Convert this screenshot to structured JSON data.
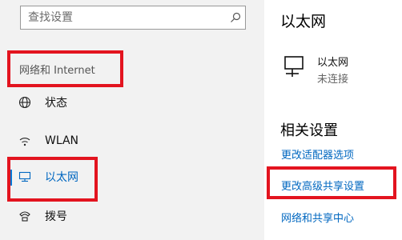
{
  "search": {
    "placeholder": "查找设置"
  },
  "sidebar": {
    "section_title": "网络和 Internet",
    "items": [
      {
        "label": "状态",
        "icon": "globe-icon"
      },
      {
        "label": "WLAN",
        "icon": "wifi-icon"
      },
      {
        "label": "以太网",
        "icon": "ethernet-icon",
        "active": true
      },
      {
        "label": "拨号",
        "icon": "dialup-icon"
      }
    ]
  },
  "main": {
    "title": "以太网",
    "connection": {
      "name": "以太网",
      "status": "未连接",
      "icon": "ethernet-monitor-icon"
    },
    "related_title": "相关设置",
    "links": [
      "更改适配器选项",
      "更改高级共享设置",
      "网络和共享中心"
    ]
  },
  "colors": {
    "accent": "#0078d7",
    "link": "#0067c0",
    "highlight": "#e3141f",
    "sidebar_bg": "#f2f2f2"
  }
}
